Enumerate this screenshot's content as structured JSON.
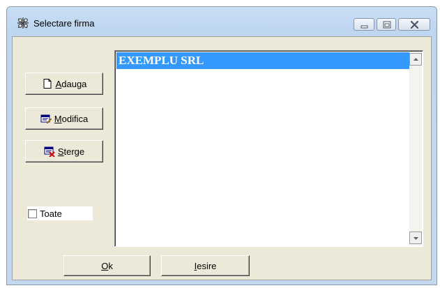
{
  "window": {
    "title": "Selectare firma",
    "icon": "network-tools-icon"
  },
  "caption_buttons": {
    "minimize": "minimize-icon",
    "maximize": "maximize-icon",
    "close": "close-icon"
  },
  "buttons": {
    "add": {
      "mnemonic": "A",
      "rest": "dauga",
      "icon": "new-document-icon"
    },
    "modify": {
      "mnemonic": "M",
      "rest": "odifica",
      "icon": "edit-form-icon"
    },
    "delete": {
      "mnemonic": "S",
      "rest": "terge",
      "icon": "delete-form-icon"
    },
    "ok": {
      "mnemonic": "O",
      "rest": "k"
    },
    "exit": {
      "mnemonic": "I",
      "rest": "esire"
    }
  },
  "filter": {
    "all_label": "Toate",
    "checked": false
  },
  "company_list": {
    "items": [
      "EXEMPLU SRL"
    ],
    "selected_index": 0
  },
  "colors": {
    "selection": "#3399ff",
    "face": "#ece9d8"
  }
}
